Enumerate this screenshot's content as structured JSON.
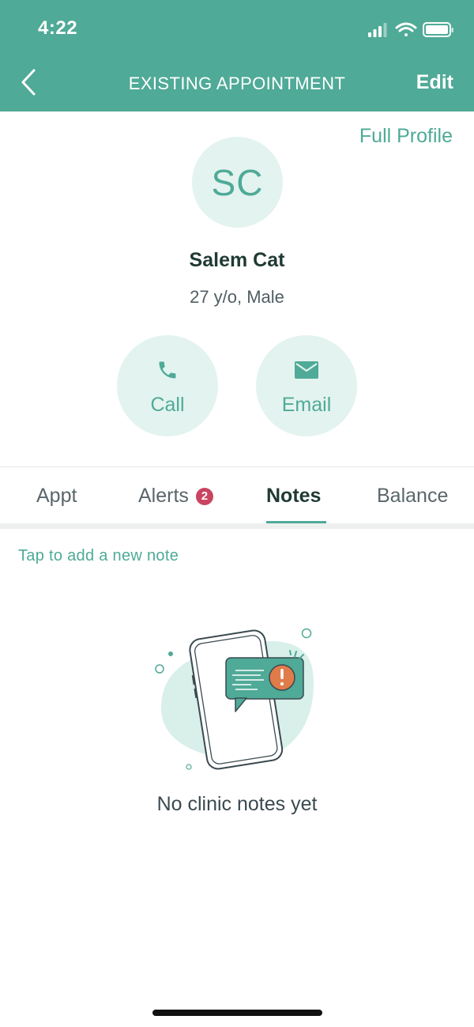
{
  "status_bar": {
    "time": "4:22"
  },
  "nav": {
    "title": "EXISTING APPOINTMENT",
    "edit_label": "Edit"
  },
  "profile": {
    "full_profile_label": "Full Profile",
    "initials": "SC",
    "name": "Salem Cat",
    "info": "27 y/o, Male"
  },
  "actions": {
    "call_label": "Call",
    "email_label": "Email"
  },
  "tabs": [
    {
      "label": "Appt"
    },
    {
      "label": "Alerts",
      "badge": "2"
    },
    {
      "label": "Notes",
      "active": true
    },
    {
      "label": "Balance"
    }
  ],
  "notes": {
    "add_note_label": "Tap to add a new note",
    "empty_text": "No clinic notes yet"
  },
  "colors": {
    "brand": "#4faa97",
    "brand_light": "#e3f3ef",
    "badge": "#c9445f",
    "alert_orange": "#e07b4a"
  }
}
